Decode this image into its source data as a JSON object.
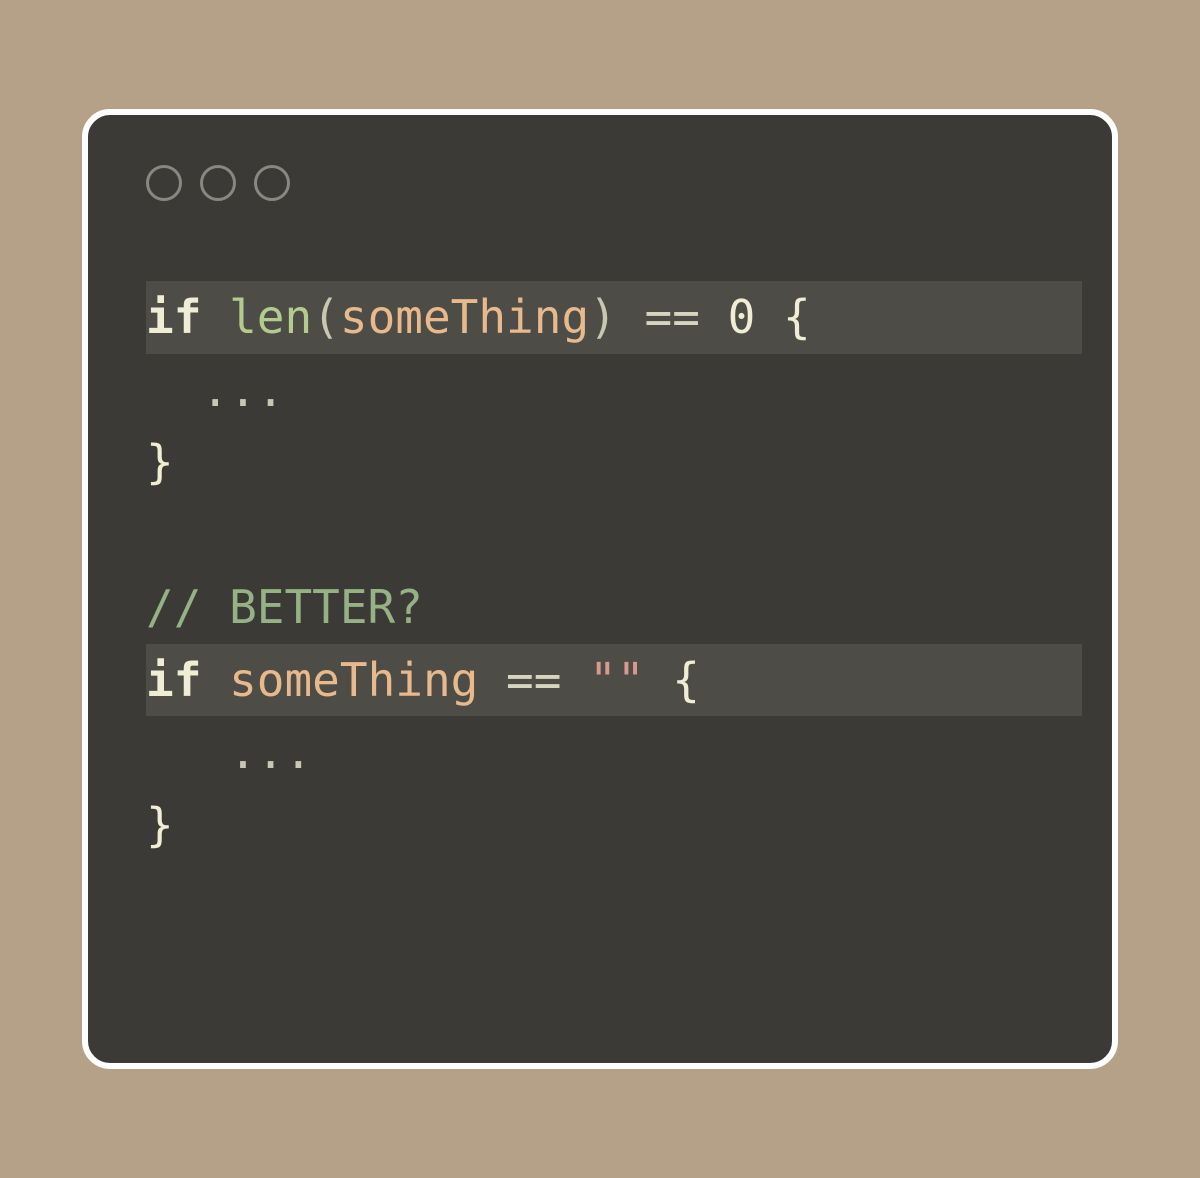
{
  "colors": {
    "page_bg": "#b5a188",
    "window_bg": "#3b3a36",
    "window_border": "#ffffff",
    "highlight_bg": "#4d4c47",
    "traffic_light_border": "#888883",
    "keyword": "#efeed4",
    "function": "#b3cc8e",
    "identifier": "#e7b98c",
    "punctuation": "#c8c7b2",
    "operator": "#d6d5c0",
    "number": "#efeed4",
    "brace": "#efeed4",
    "comment": "#95b185",
    "string": "#d89a8c"
  },
  "block1": {
    "if": "if",
    "sp1": " ",
    "len": "len",
    "lparen": "(",
    "ident": "someThing",
    "rparen": ")",
    "sp2": " ",
    "eq": "==",
    "sp3": " ",
    "zero": "0",
    "sp4": " ",
    "lbrace": "{",
    "body": "  ...",
    "rbrace": "}"
  },
  "comment_line": "// BETTER?",
  "block2": {
    "if": "if",
    "sp1": " ",
    "ident": "someThing",
    "sp2": " ",
    "eq": "==",
    "sp3": " ",
    "str": "\"\"",
    "sp4": " ",
    "lbrace": "{",
    "body": "   ...",
    "rbrace": "}"
  }
}
